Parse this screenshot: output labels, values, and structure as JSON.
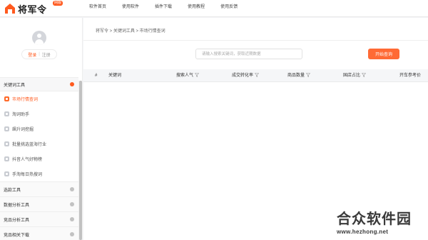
{
  "brand": {
    "name": "将军令",
    "badge": "网版",
    "accent": "#ff5a1f"
  },
  "nav": {
    "items": [
      {
        "label": "软件首页"
      },
      {
        "label": "使用软件"
      },
      {
        "label": "插件下载"
      },
      {
        "label": "使用教程"
      },
      {
        "label": "使用反馈"
      }
    ]
  },
  "user": {
    "login": "登录",
    "separator": "|",
    "register": "注册"
  },
  "sidebar": {
    "open_group": {
      "label": "关键词工具",
      "items": [
        {
          "label": "市场行情查词"
        },
        {
          "label": "淘词助手"
        },
        {
          "label": "飙升词挖掘"
        },
        {
          "label": "批量挑选蓝海行业"
        },
        {
          "label": "抖音人气好物榜"
        },
        {
          "label": "手淘每日热搜词"
        }
      ]
    },
    "closed_groups": [
      {
        "label": "选款工具"
      },
      {
        "label": "数据分析工具"
      },
      {
        "label": "竞品分析工具"
      },
      {
        "label": "竞品相关下载"
      }
    ]
  },
  "main": {
    "breadcrumb": "将军令 > 关键词工具 > 市场行情查词",
    "search": {
      "placeholder": "请输入搜索关键词，获取近期数据",
      "button": "开始查询"
    },
    "table": {
      "columns": [
        "#",
        "关键词",
        "搜索人气",
        "成交转化率",
        "商品数量",
        "国店占比",
        "开车参考价"
      ]
    }
  },
  "watermark": {
    "title": "合众软件园",
    "url": "www.hezhong.net"
  }
}
